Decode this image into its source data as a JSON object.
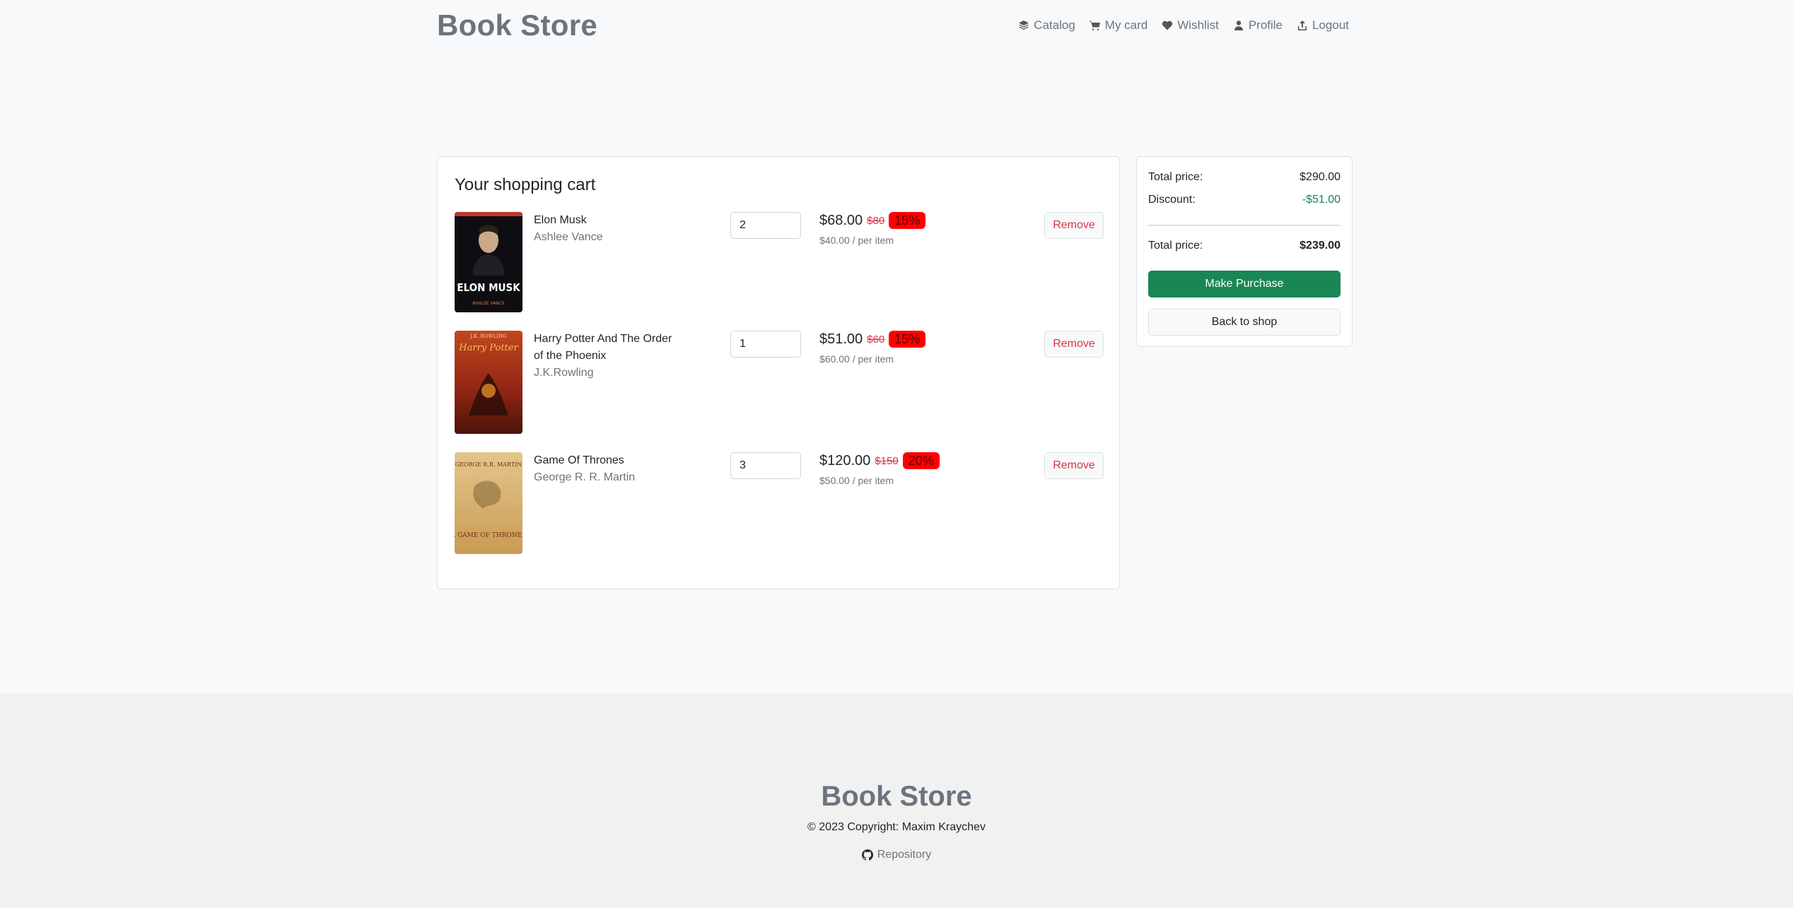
{
  "header": {
    "brand": "Book Store",
    "nav": [
      {
        "label": "Catalog",
        "icon": "layers-icon"
      },
      {
        "label": "My card",
        "icon": "cart-icon"
      },
      {
        "label": "Wishlist",
        "icon": "heart-icon"
      },
      {
        "label": "Profile",
        "icon": "person-icon"
      },
      {
        "label": "Logout",
        "icon": "logout-icon"
      }
    ]
  },
  "cart": {
    "title": "Your shopping cart",
    "remove_label": "Remove",
    "items": [
      {
        "title": "Elon Musk",
        "author": "Ashlee Vance",
        "quantity": "2",
        "price": "$68.00",
        "old_price": "$80",
        "discount": "15%",
        "per_item": "$40.00 / per item",
        "cover_text": "ELON MUSK",
        "cover_subtext": "ASHLEE VANCE",
        "cover_color": "#0e0e12"
      },
      {
        "title": "Harry Potter And The Order of the Phoenix",
        "author": "J.K.Rowling",
        "quantity": "1",
        "price": "$51.00",
        "old_price": "$60",
        "discount": "15%",
        "per_item": "$60.00 / per item",
        "cover_text": "Harry Potter",
        "cover_subtext": "J.K. ROWLING",
        "cover_color": "#b8351d"
      },
      {
        "title": "Game Of Thrones",
        "author": "George R. R. Martin",
        "quantity": "3",
        "price": "$120.00",
        "old_price": "$150",
        "discount": "20%",
        "per_item": "$50.00 / per item",
        "cover_text": "A GAME OF THRONES",
        "cover_subtext": "GEORGE R.R. MARTIN",
        "cover_color": "#d9b978"
      }
    ]
  },
  "summary": {
    "total_label": "Total price:",
    "total_value": "$290.00",
    "discount_label": "Discount:",
    "discount_value": "-$51.00",
    "final_label": "Total price:",
    "final_value": "$239.00",
    "purchase_label": "Make Purchase",
    "back_label": "Back to shop"
  },
  "footer": {
    "brand": "Book Store",
    "copyright": "© 2023 Copyright: Maxim Kraychev",
    "repo_label": "Repository"
  },
  "colors": {
    "accent_green": "#198754",
    "discount_red": "#ff0000",
    "muted": "#6c757d"
  }
}
